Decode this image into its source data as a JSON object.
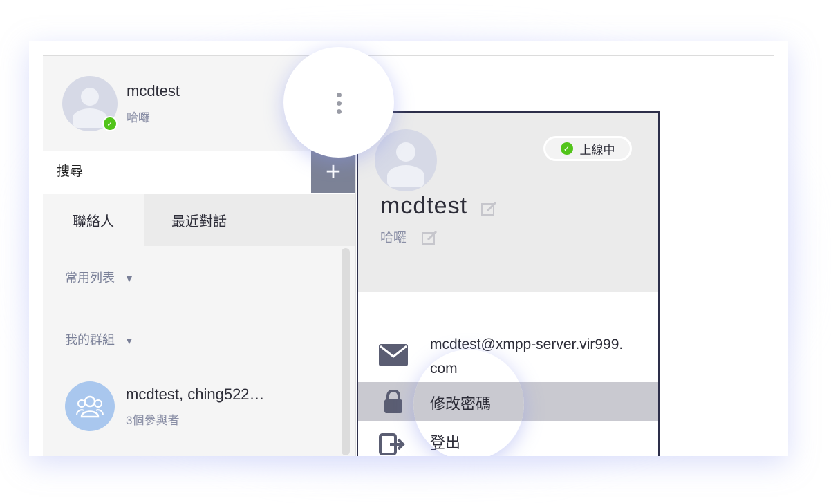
{
  "user": {
    "name": "mcdtest",
    "status": "哈囉"
  },
  "search": {
    "placeholder": "搜尋",
    "add_label": "+"
  },
  "tabs": [
    {
      "label": "聯絡人",
      "active": true
    },
    {
      "label": "最近對話",
      "active": false
    }
  ],
  "sections": [
    {
      "label": "常用列表"
    },
    {
      "label": "我的群組"
    }
  ],
  "group": {
    "name": "mcdtest, ching522…",
    "subtitle": "3個參與者"
  },
  "profile_panel": {
    "online_label": "上線中",
    "name": "mcdtest",
    "status": "哈囉",
    "email_line1": "mcdtest@xmpp-server.vir999.",
    "email_line2": "com",
    "change_password": "修改密碼",
    "logout": "登出"
  },
  "colors": {
    "accent_online": "#52c41a",
    "add_button": "#7c8296",
    "text_primary": "#2d2d38",
    "text_secondary": "#8a8fa6",
    "highlight_row": "#c9c9d0"
  },
  "icons": [
    "kebab-menu-icon",
    "online-check-icon",
    "plus-icon",
    "dropdown-triangle-icon",
    "group-users-icon",
    "edit-pencil-icon",
    "envelope-icon",
    "lock-icon",
    "logout-icon"
  ]
}
